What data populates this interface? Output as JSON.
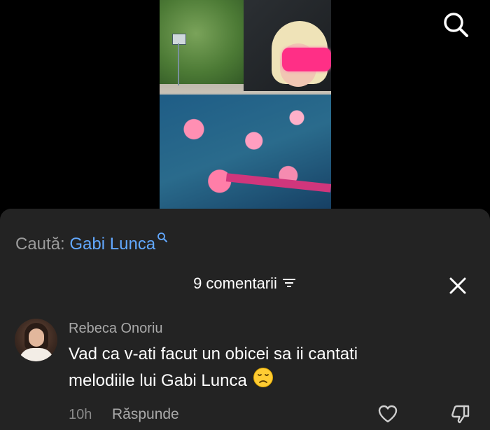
{
  "video": {
    "description_icon": "video-frame"
  },
  "top_bar": {
    "search_icon": "search-icon"
  },
  "search_suggestion": {
    "prefix": "Caută:",
    "term": "Gabi Lunca",
    "icon": "mini-search-icon"
  },
  "comments_header": {
    "count_label": "9 comentarii",
    "filter_icon": "filter-icon",
    "close_icon": "close-icon"
  },
  "comment": {
    "username": "Rebeca Onoriu",
    "text": "Vad ca v-ati facut un obicei sa ii cantati melodiile lui Gabi Lunca",
    "emoji": "disappointed-face",
    "time": "10h",
    "reply_label": "Răspunde",
    "like_icon": "heart-icon",
    "dislike_icon": "thumbs-down-icon"
  },
  "colors": {
    "background": "#000000",
    "sheet": "#232323",
    "link": "#62a8ff",
    "text_primary": "#ffffff",
    "text_secondary": "#a9a9a9"
  }
}
